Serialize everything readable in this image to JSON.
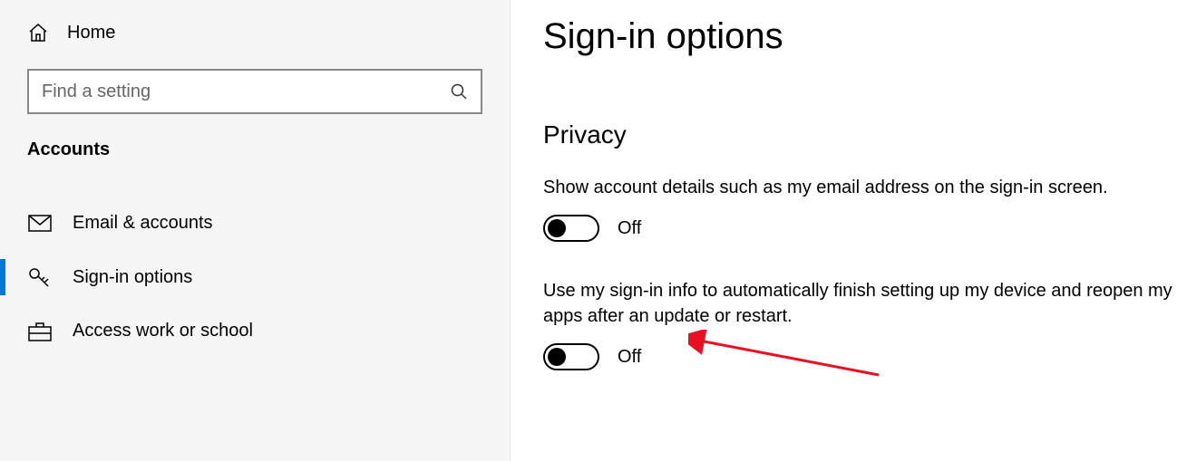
{
  "sidebar": {
    "home_label": "Home",
    "search_placeholder": "Find a setting",
    "section_label": "Accounts",
    "items": [
      {
        "label": "Email & accounts",
        "icon": "mail-icon",
        "active": false
      },
      {
        "label": "Sign-in options",
        "icon": "key-icon",
        "active": true
      },
      {
        "label": "Access work or school",
        "icon": "briefcase-icon",
        "active": false
      }
    ]
  },
  "content": {
    "title": "Sign-in options",
    "group_title": "Privacy",
    "settings": [
      {
        "description": "Show account details such as my email address on the sign-in screen.",
        "state_label": "Off",
        "on": false
      },
      {
        "description": "Use my sign-in info to automatically finish setting up my device and reopen my apps after an update or restart.",
        "state_label": "Off",
        "on": false,
        "annotated": true
      }
    ]
  },
  "colors": {
    "accent": "#0078D4",
    "arrow": "#E81123"
  }
}
